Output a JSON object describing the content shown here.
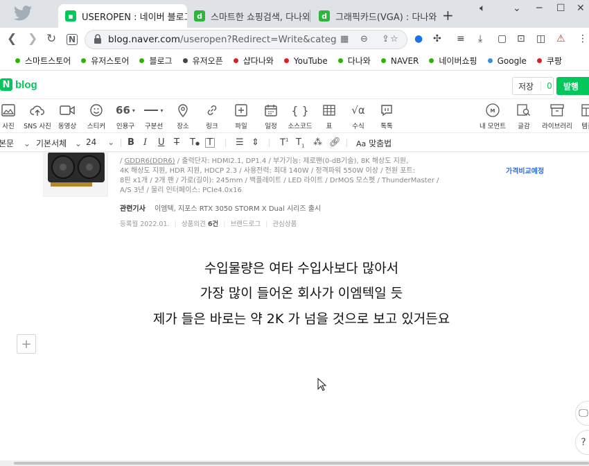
{
  "browser": {
    "tabs": [
      {
        "title": "USEROPEN : 네이버 블로그",
        "icon": "naver-blog-icon",
        "active": true
      },
      {
        "title": "스마트한 쇼핑검색, 다나와!",
        "icon": "danawa-icon",
        "active": false
      },
      {
        "title": "그래픽카드(VGA) : 다나와 가",
        "icon": "danawa-icon",
        "active": false
      }
    ],
    "new_tab": "+",
    "url_host": "blog.naver.com",
    "url_path": "/useropen?Redirect=Write&categoryN...",
    "bookmarks": [
      {
        "label": "스마트스토어",
        "color": "#2db400"
      },
      {
        "label": "유저스토어",
        "color": "#2db400"
      },
      {
        "label": "블로그",
        "color": "#2db400"
      },
      {
        "label": "유저오픈",
        "color": "#444444"
      },
      {
        "label": "샵다나와",
        "color": "#e02020"
      },
      {
        "label": "YouTube",
        "color": "#e02020"
      },
      {
        "label": "다나와",
        "color": "#2db400"
      },
      {
        "label": "NAVER",
        "color": "#2db400"
      },
      {
        "label": "네이버쇼핑",
        "color": "#2db400"
      },
      {
        "label": "Google",
        "color": "#3a8fd8"
      },
      {
        "label": "쿠팡",
        "color": "#e02020"
      }
    ]
  },
  "editor": {
    "logo_text": "blog",
    "logo_badge": "N",
    "save_label": "저장",
    "save_count": "0",
    "publish_label": "발행",
    "insert_tools": [
      "사진",
      "SNS 사진",
      "동영상",
      "스티커",
      "인용구",
      "구분선",
      "장소",
      "링크",
      "파일",
      "일정",
      "소스코드",
      "표",
      "수식",
      "톡톡"
    ],
    "right_tools": [
      "내 모먼트",
      "글감",
      "라이브러리",
      "템플"
    ],
    "format": {
      "paragraph": "본문",
      "font": "기본서체",
      "size": "24",
      "spellcheck": "맞춤법",
      "quote_glyph": "66"
    }
  },
  "product": {
    "spec_lines": [
      "/ GDDR6(DDR6) / 출력단자: HDMI2.1, DP1.4 / 부가기능: 제로팬(0-dB기술), 8K 해상도 지원,",
      "4K 해상도 지원, HDR 지원, HDCP 2.3 / 사용전력: 최대 140W / 정격파워 550W 이상 / 전원 포트:",
      "8핀 x1개 / 2개 팬 / 가로(길이): 245mm / 백플레이트 / LED 라이트 / DrMOS 모스펫 / ThunderMaster /",
      "A/S 3년 / 물리 인터페이스: PCIe4.0x16"
    ],
    "spec_underlined": "GDDR6(DDR6)",
    "price_compare": "가격비교예정",
    "related_label": "관련기사",
    "related_text": "이엠텍, 지포스 RTX 3050 STORM X Dual 시리즈 출시",
    "meta": {
      "registered": "등록월 2022.01.",
      "reviews_label": "상품의견",
      "reviews_count": "6건",
      "brand_log": "브랜드로그",
      "interest": "관심상품"
    }
  },
  "body_text": [
    "수입물량은 여타 수입사보다 많아서",
    "가장 많이 들어온 회사가 이엠텍일 듯",
    "제가 들은 바로는 약 2K 가 넘을 것으로 보고 있거든요"
  ],
  "help_button": "?",
  "colors": {
    "naver_green": "#03c75a",
    "link_blue": "#2e6ee0"
  }
}
